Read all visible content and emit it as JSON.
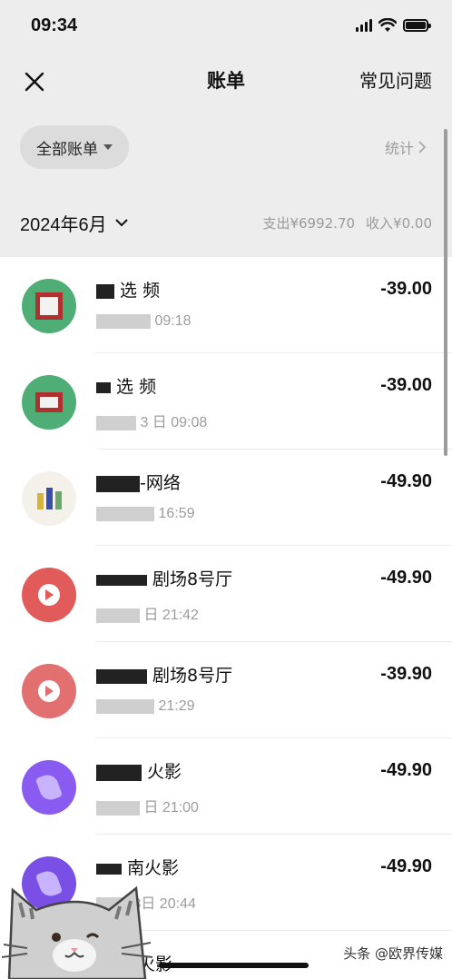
{
  "status_bar": {
    "time": "09:34"
  },
  "nav": {
    "title": "账单",
    "faq_label": "常见问题"
  },
  "filter": {
    "label": "全部账单",
    "stats_label": "统计"
  },
  "month": {
    "label": "2024年6月",
    "expense": "支出¥6992.70",
    "income": "收入¥0.00"
  },
  "transactions": [
    {
      "merchant": "选 频",
      "time": "09:18",
      "amount": "-39.00",
      "icon": "green-video-app-icon",
      "color": "#4fae76"
    },
    {
      "merchant": "选 频",
      "time": "3 日 09:08",
      "amount": "-39.00",
      "icon": "green-video-app-icon",
      "color": "#4fae76"
    },
    {
      "merchant": "-网络",
      "time": "16:59",
      "amount": "-49.90",
      "icon": "multicolor-app-icon",
      "color": "#d9c27a"
    },
    {
      "merchant": "剧场8号厅",
      "time": "日 21:42",
      "amount": "-49.90",
      "icon": "red-play-app-icon",
      "color": "#e25b5b"
    },
    {
      "merchant": "剧场8号厅",
      "time": "21:29",
      "amount": "-39.90",
      "icon": "red-play-app-icon",
      "color": "#e27070"
    },
    {
      "merchant": "火影",
      "time": "日 21:00",
      "amount": "-49.90",
      "icon": "purple-app-icon",
      "color": "#8a5bf0"
    },
    {
      "merchant": "南火影",
      "time": "8日 20:44",
      "amount": "-49.90",
      "icon": "purple-app-icon",
      "color": "#7a4fe6"
    },
    {
      "merchant": "火影",
      "time": "",
      "amount": "",
      "icon": "purple-app-icon",
      "color": "#8a5bf0"
    }
  ],
  "watermark": "头条 @欧界传媒",
  "colors": {
    "background": "#ededed",
    "list_background": "#ffffff",
    "secondary_text": "#9c9c9c"
  }
}
